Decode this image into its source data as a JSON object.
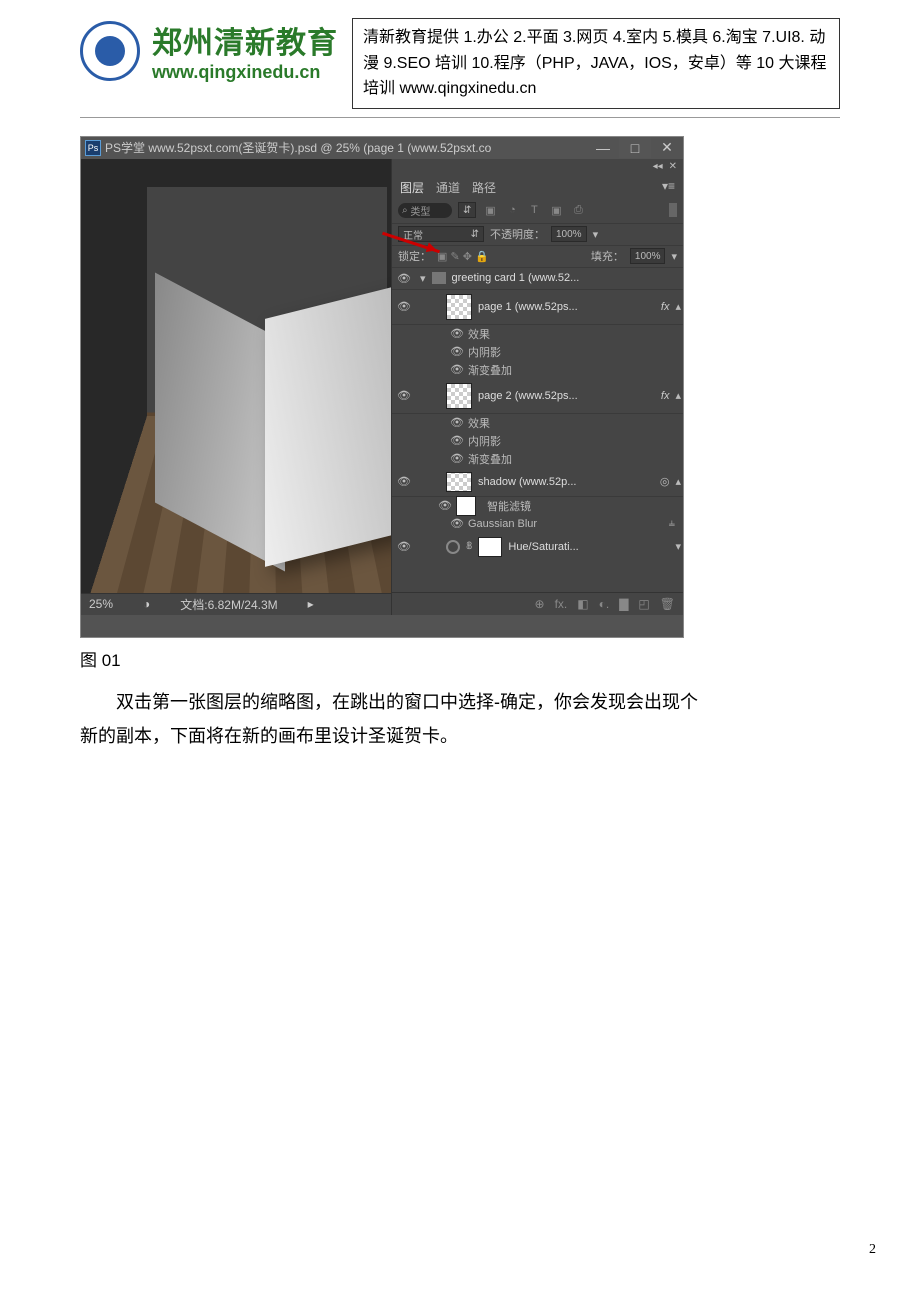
{
  "header": {
    "brand": "郑州清新教育",
    "brand_url": "www.qingxinedu.cn",
    "box_text": "清新教育提供 1.办公 2.平面 3.网页 4.室内 5.模具 6.淘宝 7.UI8. 动漫 9.SEO 培训 10.程序（PHP，JAVA，IOS，安卓）等 10 大课程培训  www.qingxinedu.cn"
  },
  "ps": {
    "app_icon": "Ps",
    "title": "PS学堂 www.52psxt.com(圣诞贺卡).psd @ 25% (page 1 (www.52psxt.co",
    "win_min": "—",
    "win_max": "□",
    "win_close": "✕",
    "collapse": "◂◂",
    "tabs": {
      "layers": "图层",
      "channels": "通道",
      "paths": "路径"
    },
    "type_label": "类型",
    "search_icon": "⌕",
    "dd_arrow": "⇵",
    "filter_icons": [
      "▣",
      "◔",
      "T",
      "▣",
      "⎙"
    ],
    "blend": "正常",
    "opacity_label": "不透明度：",
    "opacity_value": "100%",
    "lock_label": "锁定：",
    "lock_icons": "▣ ✎ ✥ 🔒",
    "fill_label": "填充：",
    "fill_value": "100%",
    "group": {
      "name": "greeting card 1 (www.52...",
      "arrow": "▾"
    },
    "layer1": {
      "name": "page 1 (www.52ps...",
      "fx": "fx"
    },
    "layer2": {
      "name": "page 2 (www.52ps...",
      "fx": "fx"
    },
    "effects": "效果",
    "inner_shadow": "内阴影",
    "gradient_overlay": "渐变叠加",
    "shadow": {
      "name": "shadow (www.52p...",
      "so": "◎"
    },
    "smart_filter": "智能滤镜",
    "gaussian": "Gaussian Blur",
    "gaussian_icon": "⫨",
    "hue": "Hue/Saturati...",
    "panel_bottom": [
      "⊕",
      "fx.",
      "◧",
      "◐.",
      "▇",
      "◰",
      "🗑"
    ],
    "zoom": "25%",
    "doc": "文档:6.82M/24.3M",
    "status_icon": "◑",
    "status_play": "▸"
  },
  "caption": "图 01",
  "body_para1": "双击第一张图层的缩略图，在跳出的窗口中选择-确定，你会发现会出现个",
  "body_para2": "新的副本，下面将在新的画布里设计圣诞贺卡。",
  "page_number": "2"
}
